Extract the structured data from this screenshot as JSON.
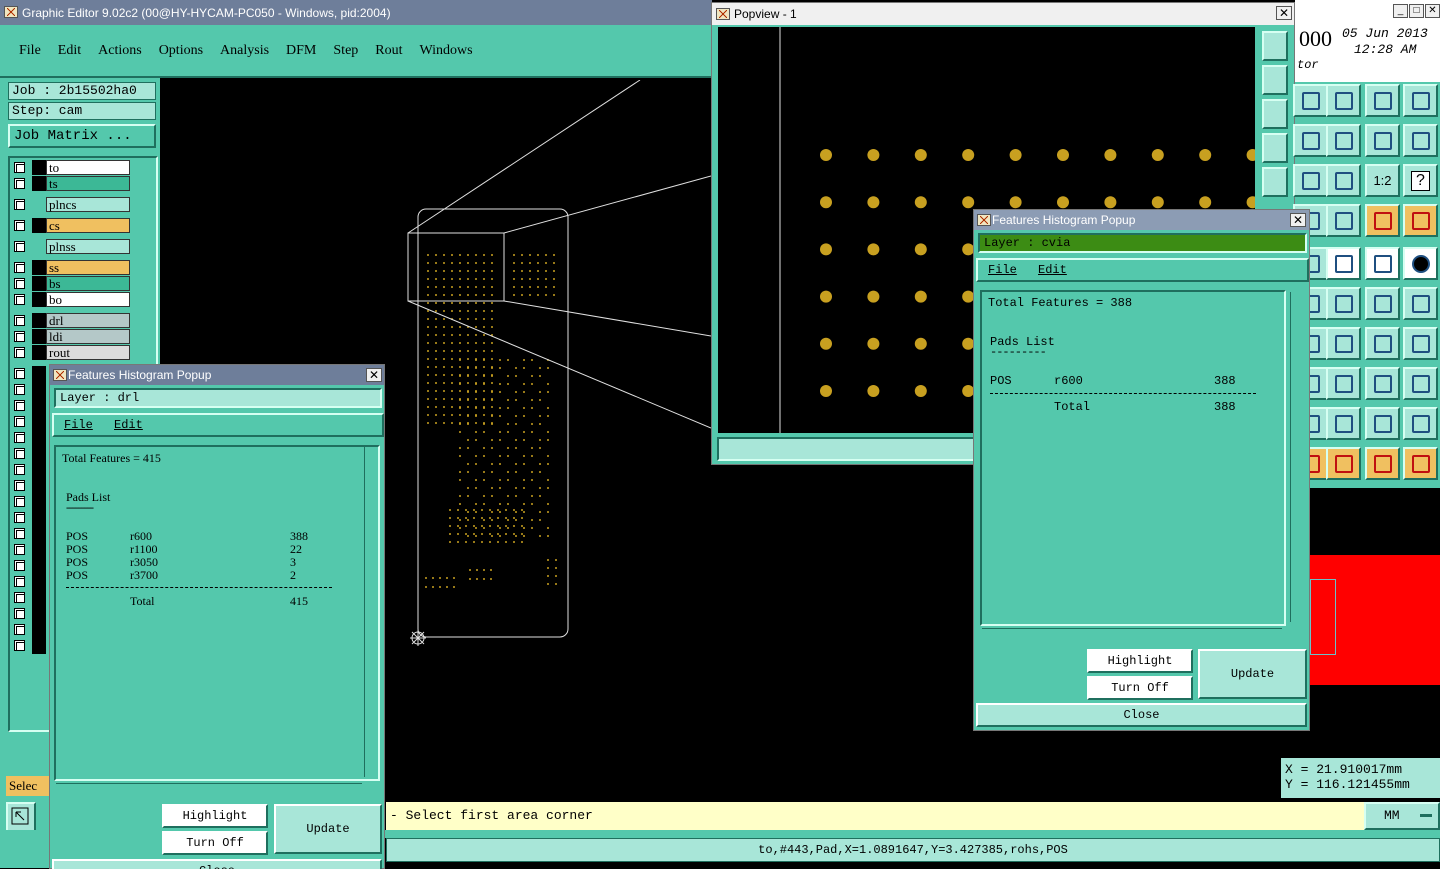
{
  "main_window": {
    "title": "Graphic Editor 9.02c2 (00@HY-HYCAM-PC050 - Windows, pid:2004)",
    "menu": [
      "File",
      "Edit",
      "Actions",
      "Options",
      "Analysis",
      "DFM",
      "Step",
      "Rout",
      "Windows"
    ]
  },
  "job_info": {
    "job": "Job  : 2b15502ha0",
    "step": "Step: cam",
    "job_matrix": "Job Matrix ..."
  },
  "layers": [
    {
      "name": "to",
      "color": "#ffffff"
    },
    {
      "name": "ts",
      "color": "#3cb896"
    },
    {
      "name": "plncs",
      "color": "#a8e6d8"
    },
    {
      "name": "cs",
      "color": "#f0c060"
    },
    {
      "name": "plnss",
      "color": "#a8e6d8"
    },
    {
      "name": "ss",
      "color": "#f0c060"
    },
    {
      "name": "bs",
      "color": "#3cb896"
    },
    {
      "name": "bo",
      "color": "#ffffff"
    },
    {
      "name": "drl",
      "color": "#b4c8c8"
    },
    {
      "name": "ldi",
      "color": "#b4c8c8"
    },
    {
      "name": "rout",
      "color": "#dcdcdc"
    }
  ],
  "left_bottom_label": "Selec",
  "popview": {
    "title": "Popview - 1"
  },
  "clock": {
    "partial": "000",
    "date": "05 Jun 2013",
    "time": "12:28 AM",
    "sub": "tor"
  },
  "toolbar_labels": {
    "one_to_two": "1:2",
    "help": "?"
  },
  "coords": {
    "x": "X  =  21.910017mm",
    "y": "Y  = 116.121455mm"
  },
  "prompt": "- Select first area corner",
  "units": "MM",
  "feature_info": "to,#443,Pad,X=1.0891647,Y=3.427385,rohs,POS",
  "hist_drl": {
    "title": "Features Histogram Popup",
    "layer": "Layer :  drl",
    "menu": [
      "File",
      "Edit"
    ],
    "total": "Total Features = 415",
    "section": "Pads List",
    "underline": "---------",
    "rows": [
      {
        "type": "POS",
        "sym": "r600",
        "count": "388"
      },
      {
        "type": "POS",
        "sym": "r1100",
        "count": "22"
      },
      {
        "type": "POS",
        "sym": "r3050",
        "count": "3"
      },
      {
        "type": "POS",
        "sym": "r3700",
        "count": "2"
      }
    ],
    "total_label": "Total",
    "total_count": "415",
    "highlight": "Highlight",
    "turn_off": "Turn Off",
    "update": "Update",
    "close": "Close"
  },
  "hist_cvia": {
    "title": "Features Histogram Popup",
    "layer": "Layer :  cvia",
    "menu": [
      "File",
      "Edit"
    ],
    "total": "Total Features = 388",
    "section": "Pads List",
    "underline": "---------",
    "rows": [
      {
        "type": "POS",
        "sym": "r600",
        "count": "388"
      }
    ],
    "total_label": "Total",
    "total_count": "388",
    "highlight": "Highlight",
    "turn_off": "Turn Off",
    "update": "Update",
    "close": "Close"
  },
  "colors": {
    "panel": "#54c8ac",
    "panel_light": "#a8e6d8",
    "pad": "#c8a020",
    "cvia_layer": "#3c8c14",
    "prompt_bg": "#ffffc8"
  }
}
